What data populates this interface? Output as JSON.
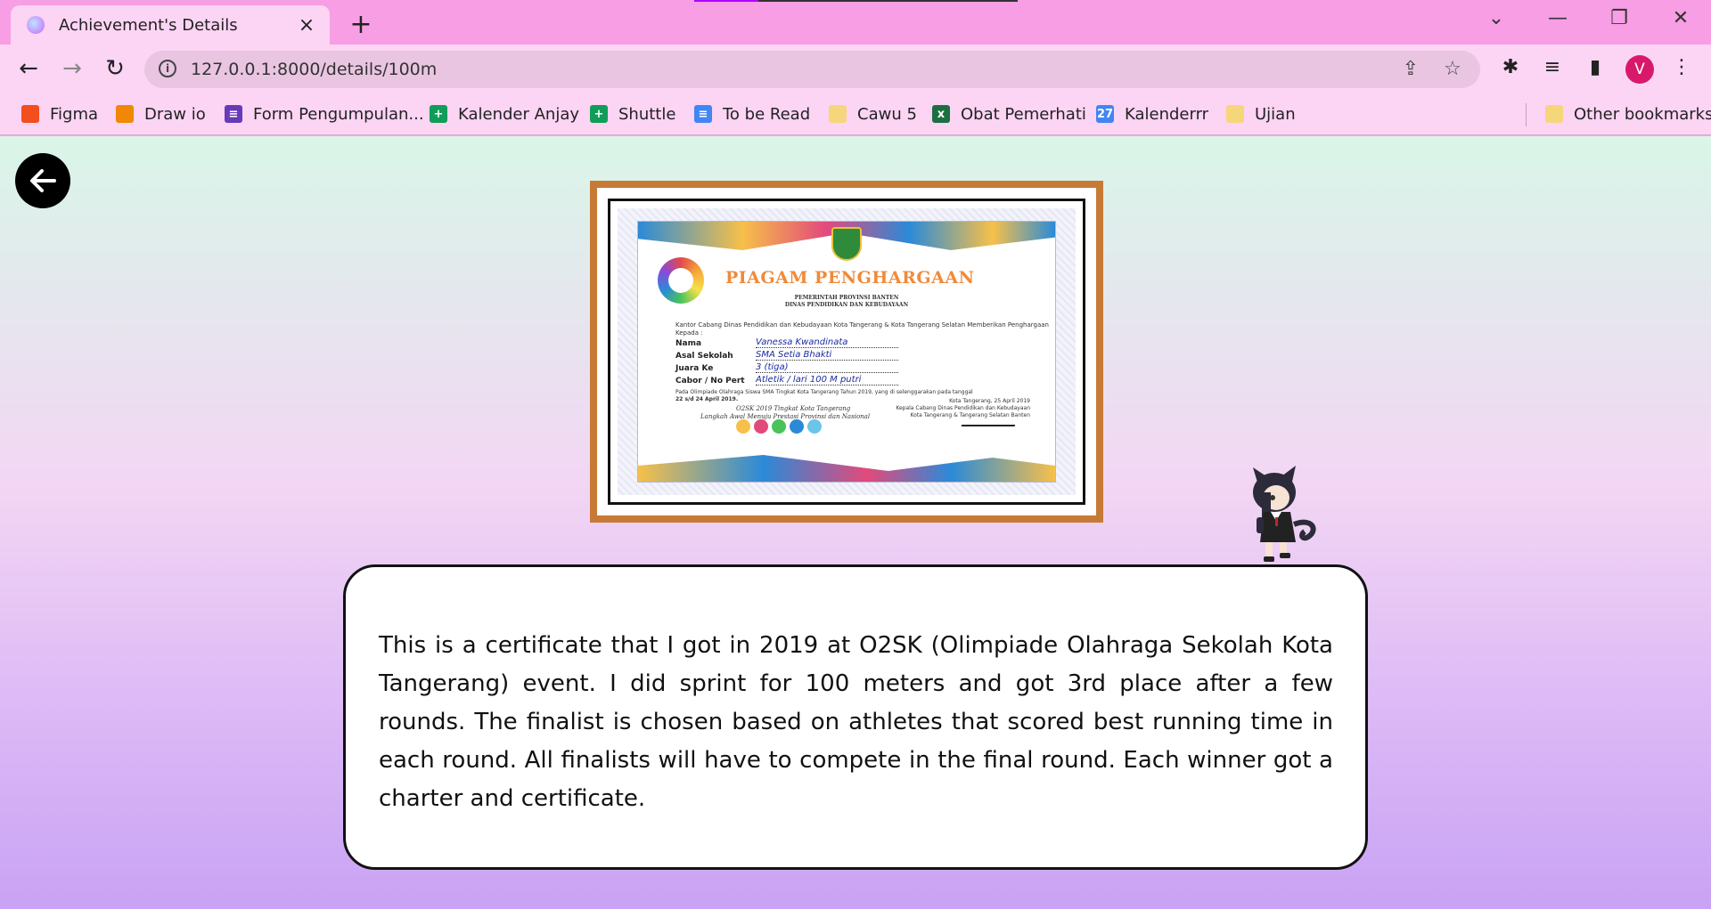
{
  "browser": {
    "tab": {
      "title": "Achievement's Details",
      "close_icon": "×"
    },
    "new_tab_icon": "+",
    "window_controls": {
      "dropdown": "⌄",
      "minimize": "—",
      "restore": "❐",
      "close": "✕"
    },
    "url": "127.0.0.1:8000/details/100m",
    "profile_initial": "V",
    "bookmarks": [
      {
        "label": "Figma",
        "icon": "figma-icon",
        "color": "#f24e1e"
      },
      {
        "label": "Draw io",
        "icon": "drawio-icon",
        "color": "#f08705"
      },
      {
        "label": "Form Pengumpulan...",
        "icon": "forms-icon",
        "color": "#673ab7"
      },
      {
        "label": "Kalender Anjay",
        "icon": "sheets-icon",
        "color": "#0f9d58"
      },
      {
        "label": "Shuttle",
        "icon": "sheets-icon",
        "color": "#0f9d58"
      },
      {
        "label": "To be Read",
        "icon": "docs-icon",
        "color": "#4285f4"
      },
      {
        "label": "Cawu 5",
        "icon": "folder-icon",
        "color": "#f6d67a"
      },
      {
        "label": "Obat Pemerhati",
        "icon": "excel-icon",
        "color": "#1d6f42"
      },
      {
        "label": "Kalenderrr",
        "icon": "calendar-icon",
        "color": "#4285f4"
      },
      {
        "label": "Ujian",
        "icon": "folder-icon",
        "color": "#f6d67a"
      }
    ],
    "other_bookmarks": "Other bookmarks"
  },
  "page": {
    "back_button": "back-arrow-icon",
    "certificate": {
      "title": "PIAGAM PENGHARGAAN",
      "issuer_line1": "PEMERINTAH PROVINSI BANTEN",
      "issuer_line2": "DINAS PENDIDIKAN DAN KEBUDAYAAN",
      "intro": "Kantor Cabang Dinas Pendidikan dan Kebudayaan Kota Tangerang & Kota Tangerang Selatan Memberikan Penghargaan",
      "to": "Kepada :",
      "fields": [
        {
          "label": "Nama",
          "value": "Vanessa Kwandinata"
        },
        {
          "label": "Asal Sekolah",
          "value": "SMA Setia Bhakti"
        },
        {
          "label": "Juara Ke",
          "value": "3 (tiga)"
        },
        {
          "label": "Cabor / No Pert",
          "value": "Atletik / lari 100 M putri"
        }
      ],
      "event_line": "Pada Olimpiade Olahraga Siswa SMA Tingkat Kota Tangerang Tahun 2019, yang di selenggarakan pada tanggal",
      "event_date": "22 s/d 24 April 2019.",
      "motto_line1": "O2SK 2019 Tingkat Kota Tangerang",
      "motto_line2": "Langkah Awal Menuju Prestasi Provinsi dan Nasional",
      "sign_line1": "Kota Tangerang, 25 April 2019",
      "sign_line2": "Kepala Cabang Dinas Pendidikan dan Kebudayaan",
      "sign_line3": "Kota Tangerang & Tangerang Selatan Banten"
    },
    "description": "This is a certificate that I got in 2019 at O2SK (Olimpiade Olahraga Sekolah Kota Tangerang) event. I did sprint for 100 meters and got 3rd place after a few rounds. The finalist is chosen based on athletes that scored best running time in each round. All finalists will have to compete in the final round. Each winner got a charter and certificate."
  }
}
